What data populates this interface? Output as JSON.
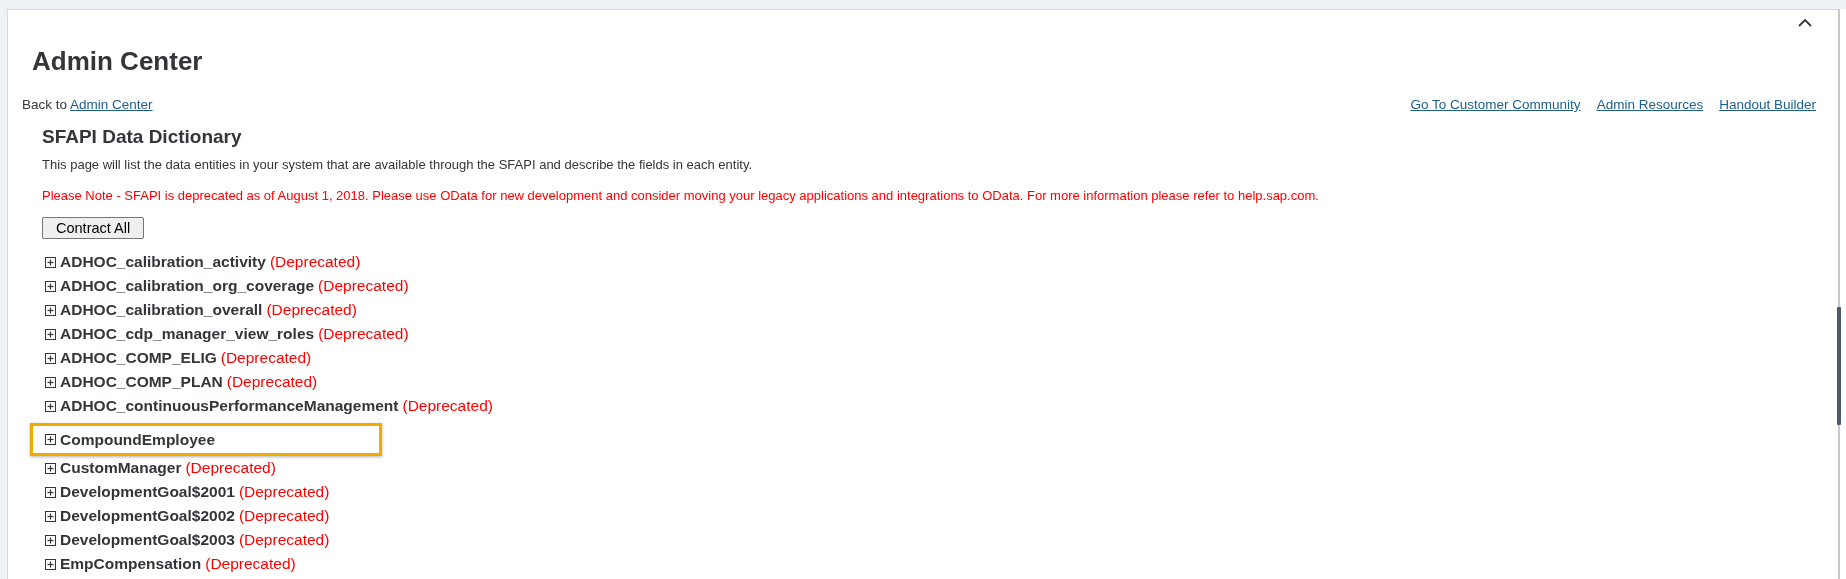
{
  "page": {
    "title": "Admin Center",
    "back_prefix": "Back to",
    "back_link": "Admin Center",
    "collapse_icon": true
  },
  "top_links": [
    "Go To Customer Community",
    "Admin Resources",
    "Handout Builder"
  ],
  "section": {
    "title": "SFAPI Data Dictionary",
    "description": "This page will list the data entities in your system that are available through the SFAPI and describe the fields in each entity.",
    "note": "Please Note - SFAPI is deprecated as of August 1, 2018. Please use OData for new development and consider moving your legacy applications and integrations to OData. For more information please refer to help.sap.com.",
    "button": "Contract All"
  },
  "entities": [
    {
      "name": "ADHOC_calibration_activity",
      "status": "(Deprecated)",
      "expanded": false,
      "highlighted": false
    },
    {
      "name": "ADHOC_calibration_org_coverage",
      "status": "(Deprecated)",
      "expanded": false,
      "highlighted": false
    },
    {
      "name": "ADHOC_calibration_overall",
      "status": "(Deprecated)",
      "expanded": false,
      "highlighted": false
    },
    {
      "name": "ADHOC_cdp_manager_view_roles",
      "status": "(Deprecated)",
      "expanded": false,
      "highlighted": false
    },
    {
      "name": "ADHOC_COMP_ELIG",
      "status": "(Deprecated)",
      "expanded": false,
      "highlighted": false
    },
    {
      "name": "ADHOC_COMP_PLAN",
      "status": "(Deprecated)",
      "expanded": false,
      "highlighted": false
    },
    {
      "name": "ADHOC_continuousPerformanceManagement",
      "status": "(Deprecated)",
      "expanded": false,
      "highlighted": false
    },
    {
      "name": "CompoundEmployee",
      "expanded": false,
      "highlighted": true
    },
    {
      "name": "CustomManager",
      "status": "(Deprecated)",
      "expanded": false,
      "highlighted": false
    },
    {
      "name": "DevelopmentGoal$2001",
      "status": "(Deprecated)",
      "expanded": false,
      "highlighted": false
    },
    {
      "name": "DevelopmentGoal$2002",
      "status": "(Deprecated)",
      "expanded": false,
      "highlighted": false
    },
    {
      "name": "DevelopmentGoal$2003",
      "status": "(Deprecated)",
      "expanded": false,
      "highlighted": false
    },
    {
      "name": "EmpCompensation",
      "status": "(Deprecated)",
      "expanded": false,
      "highlighted": false
    }
  ]
}
